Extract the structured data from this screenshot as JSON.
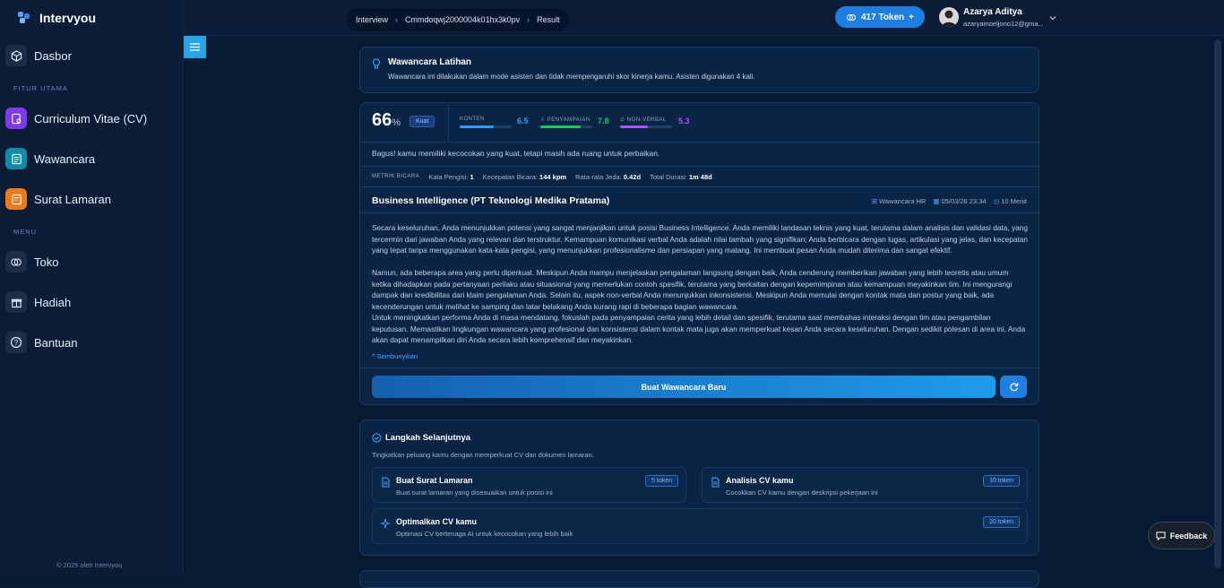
{
  "app": {
    "name": "Intervyou"
  },
  "sidebar": {
    "items": [
      {
        "label": "Dasbor",
        "icon": "cube-icon"
      },
      {
        "label": "Curriculum Vitae (CV)",
        "icon": "cv-document-icon"
      },
      {
        "label": "Wawancara",
        "icon": "chat-icon"
      },
      {
        "label": "Surat Lamaran",
        "icon": "letter-icon"
      },
      {
        "label": "Toko",
        "icon": "coins-icon"
      },
      {
        "label": "Hadiah",
        "icon": "gift-icon"
      },
      {
        "label": "Bantuan",
        "icon": "help-icon"
      }
    ],
    "section_main": "FITUR UTAMA",
    "section_menu": "MENU",
    "copyright": "© 2025 oleh Intervyou"
  },
  "breadcrumb": [
    "Interview",
    "Cmmdoqwj2000004k01hx3k0pv",
    "Result"
  ],
  "token": {
    "label": "417 Token",
    "plus": "+"
  },
  "user": {
    "name": "Azarya Aditya",
    "email": "azaryamoeljono12@gma..."
  },
  "info": {
    "title": "Wawancara Latihan",
    "description": "Wawancara ini dilakukan dalam mode asisten dan tidak mempengaruhi skor kinerja kamu. Asisten digunakan 4 kali."
  },
  "result": {
    "score": "66",
    "score_unit": "%",
    "badge": "Kuat",
    "metrics": [
      {
        "label": "KONTEN",
        "value": "6.5",
        "fraction": 0.65,
        "color": "#2f9bff"
      },
      {
        "label": "PENYAMPAIAN",
        "value": "7.8",
        "fraction": 0.78,
        "color": "#22c55e"
      },
      {
        "label": "NON-VERBAL",
        "value": "5.3",
        "fraction": 0.53,
        "color": "#a855f7"
      }
    ],
    "summary": "Bagus! kamu memiliki kecocokan yang kuat, tetapi masih ada ruang untuk perbaikan.",
    "stats_label": "METRIK BICARA",
    "stats": [
      {
        "label": "Kata Pengisi:",
        "value": "1"
      },
      {
        "label": "Kecepatan Bicara:",
        "value": "144 kpm"
      },
      {
        "label": "Rata-rata Jeda:",
        "value": "0.42d"
      },
      {
        "label": "Total Durasi:",
        "value": "1m 48d"
      }
    ],
    "job_title": "Business Intelligence (PT Teknologi Medika Pratama)",
    "meta": {
      "type": "Wawancara HR",
      "date": "05/03/26 23.34",
      "duration": "10 Menit"
    },
    "paragraphs": [
      "Secara keseluruhan, Anda menunjukkan potensi yang sangat menjanjikan untuk posisi Business Intelligence. Anda memiliki landasan teknis yang kuat, terutama dalam analisis dan validasi data, yang tercermin dari jawaban Anda yang relevan dan terstruktur. Kemampuan komunikasi verbal Anda adalah nilai tambah yang signifikan; Anda berbicara dengan lugas, artikulasi yang jelas, dan kecepatan yang tepat tanpa menggunakan kata-kata pengisi, yang menunjukkan profesionalisme dan persiapan yang matang. Ini membuat pesan Anda mudah diterima dan sangat efektif.",
      "Namun, ada beberapa area yang perlu diperkuat. Meskipun Anda mampu menjelaskan pengalaman langsung dengan baik, Anda cenderung memberikan jawaban yang lebih teoretis atau umum ketika dihadapkan pada pertanyaan perilaku atau situasional yang memerlukan contoh spesifik, terutama yang berkaitan dengan kepemimpinan atau kemampuan meyakinkan tim. Ini mengurangi dampak dan kredibilitas dari klaim pengalaman Anda. Selain itu, aspek non-verbal Anda menunjukkan inkonsistensi. Meskipun Anda memulai dengan kontak mata dan postur yang baik, ada kecenderungan untuk melihat ke samping dan latar belakang Anda kurang rapi di beberapa bagian wawancara.",
      "Untuk meningkatkan performa Anda di masa mendatang, fokuslah pada penyampaian cerita yang lebih detail dan spesifik, terutama saat membahas interaksi dengan tim atau pengambilan keputusan. Memastikan lingkungan wawancara yang profesional dan konsistensi dalam kontak mata juga akan memperkuat kesan Anda secara keseluruhan. Dengan sedikit polesan di area ini, Anda akan dapat menampilkan diri Anda secara lebih komprehensif dan meyakinkan."
    ],
    "hide_label": "^ Sembunyikan",
    "new_button": "Buat Wawancara Baru"
  },
  "next_steps": {
    "title": "Langkah Selanjutnya",
    "subtitle": "Tingkatkan peluang kamu dengan memperkuat CV dan dokumen lamaran.",
    "cards": [
      {
        "title": "Buat Surat Lamaran",
        "desc": "Buat surat lamaran yang disesuaikan untuk posisi ini",
        "badge": "5 token",
        "icon": "document-icon"
      },
      {
        "title": "Analisis CV kamu",
        "desc": "Cocokkan CV kamu dengan deskripsi pekerjaan ini",
        "badge": "10 token",
        "icon": "document-icon"
      },
      {
        "title": "Optimalkan CV kamu",
        "desc": "Optimasi CV bertenaga AI untuk kecocokan yang lebih baik",
        "badge": "20 token",
        "icon": "sparkle-icon"
      }
    ]
  },
  "feedback": {
    "label": "Feedback"
  }
}
